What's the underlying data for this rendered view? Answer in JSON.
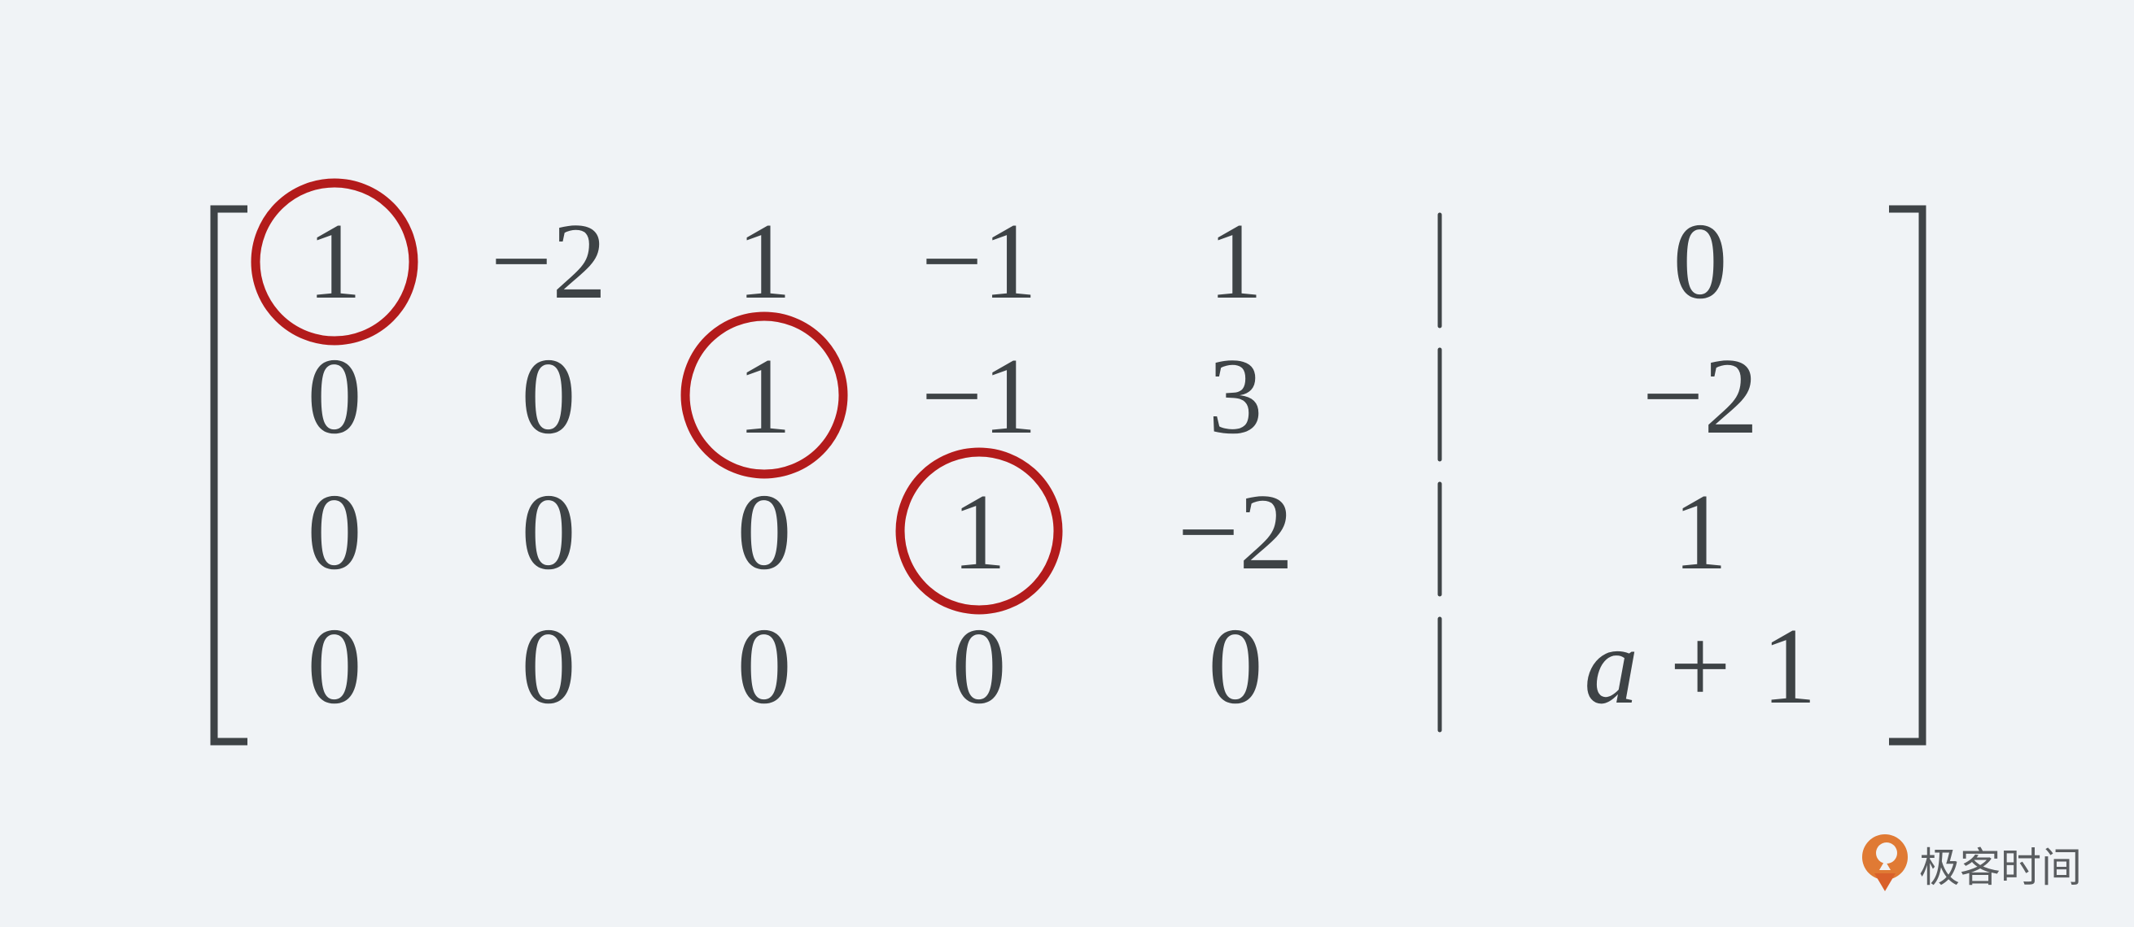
{
  "matrix": {
    "rows": [
      {
        "entries": [
          "1",
          "−2",
          "1",
          "−1",
          "1"
        ],
        "rhs": [
          "0"
        ]
      },
      {
        "entries": [
          "0",
          "0",
          "1",
          "−1",
          "3"
        ],
        "rhs": [
          "−2"
        ]
      },
      {
        "entries": [
          "0",
          "0",
          "0",
          "1",
          "−2"
        ],
        "rhs": [
          "1"
        ]
      },
      {
        "entries": [
          "0",
          "0",
          "0",
          "0",
          "0"
        ],
        "rhs": [
          "a",
          "+",
          "1"
        ]
      }
    ],
    "pivots": [
      {
        "row": 0,
        "col": 0
      },
      {
        "row": 1,
        "col": 2
      },
      {
        "row": 2,
        "col": 3
      }
    ]
  },
  "colors": {
    "background": "#f0f3f6",
    "text": "#3e4346",
    "pivot_circle": "#b31b1b",
    "brand": "#e07a34"
  },
  "brand": {
    "name": "极客时间",
    "icon": "geektime-logo-icon"
  }
}
